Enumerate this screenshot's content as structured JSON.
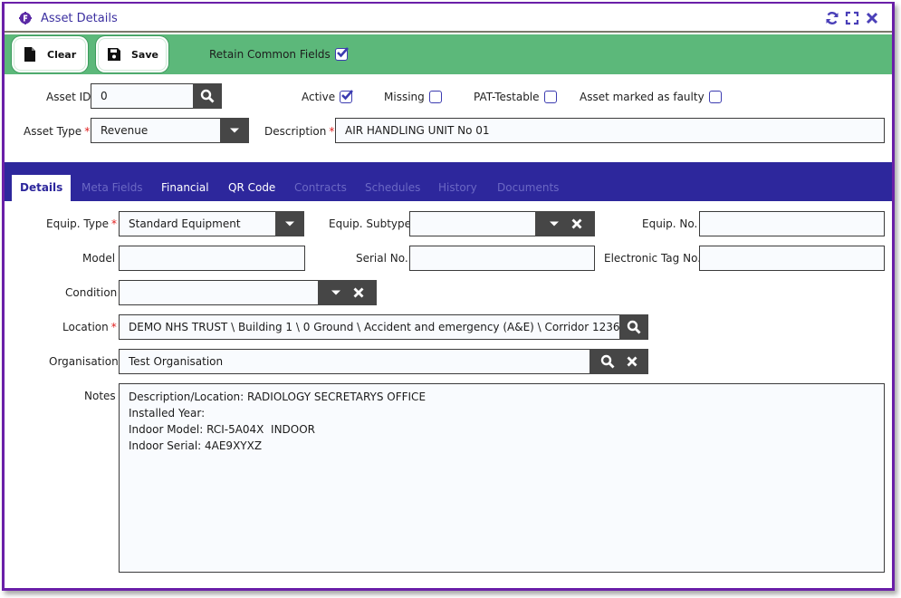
{
  "window": {
    "title": "Asset Details",
    "actions": [
      {
        "name": "refresh",
        "icon": "refresh-icon"
      },
      {
        "name": "maximize",
        "icon": "expand-icon"
      },
      {
        "name": "close",
        "icon": "close-icon"
      }
    ]
  },
  "toolbar": {
    "clear_label": "Clear",
    "save_label": "Save",
    "retain_label": "Retain Common Fields",
    "retain_checked": true
  },
  "header": {
    "asset_id_label": "Asset ID",
    "asset_id_value": "0",
    "asset_type_label": "Asset Type",
    "asset_type_value": "Revenue",
    "description_label": "Description",
    "description_value": "AIR HANDLING UNIT No 01",
    "required_marker": "*",
    "checkboxes": [
      {
        "label": "Active",
        "checked": true
      },
      {
        "label": "Missing",
        "checked": false
      },
      {
        "label": "PAT-Testable",
        "checked": false
      },
      {
        "label": "Asset marked as faulty",
        "checked": false
      }
    ]
  },
  "tabs": [
    {
      "label": "Details",
      "state": "active"
    },
    {
      "label": "Meta Fields",
      "state": "disabled"
    },
    {
      "label": "Financial",
      "state": "enabled"
    },
    {
      "label": "QR Code",
      "state": "enabled"
    },
    {
      "label": "Contracts",
      "state": "disabled"
    },
    {
      "label": "Schedules",
      "state": "disabled"
    },
    {
      "label": "History",
      "state": "disabled"
    },
    {
      "label": "Documents",
      "state": "disabled"
    }
  ],
  "details": {
    "equip_type_label": "Equip. Type",
    "equip_type_value": "Standard Equipment",
    "equip_subtype_label": "Equip. Subtype",
    "equip_subtype_value": "",
    "equip_no_label": "Equip. No.",
    "equip_no_value": "",
    "model_label": "Model",
    "model_value": "",
    "serial_no_label": "Serial No.",
    "serial_no_value": "",
    "electronic_tag_label": "Electronic Tag No.",
    "electronic_tag_value": "",
    "condition_label": "Condition",
    "condition_value": "",
    "location_label": "Location",
    "location_value": "DEMO NHS TRUST \\ Building 1 \\ 0 Ground \\ Accident and emergency (A&E) \\ Corridor 1236",
    "organisation_label": "Organisation",
    "organisation_value": "Test Organisation",
    "notes_label": "Notes",
    "notes_value": "Description/Location: RADIOLOGY SECRETARYS OFFICE\nInstalled Year:\nIndoor Model: RCI-5A04X  INDOOR\nIndoor Serial: 4AE9XYXZ"
  },
  "colors": {
    "window_border": "#6a1fa8",
    "toolbar_bg": "#5cb87a",
    "tabbar_bg": "#2d279c",
    "title_text": "#3b2fa0",
    "action_button_bg": "#464646",
    "required": "#e02020"
  }
}
